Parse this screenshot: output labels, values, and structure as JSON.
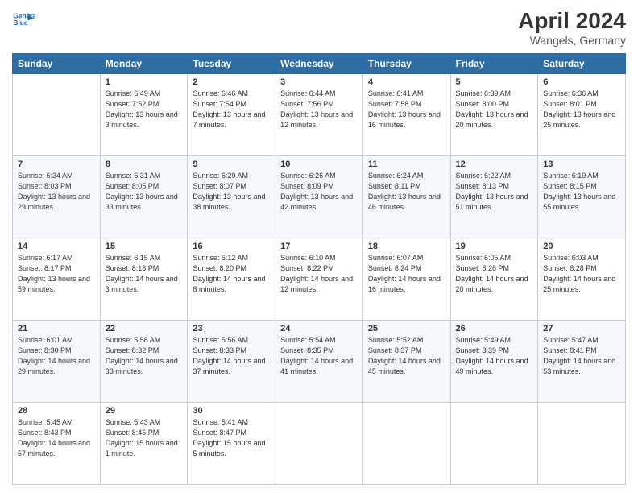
{
  "header": {
    "logo_line1": "General",
    "logo_line2": "Blue",
    "month": "April 2024",
    "location": "Wangels, Germany"
  },
  "weekdays": [
    "Sunday",
    "Monday",
    "Tuesday",
    "Wednesday",
    "Thursday",
    "Friday",
    "Saturday"
  ],
  "weeks": [
    [
      {
        "day": "",
        "sunrise": "",
        "sunset": "",
        "daylight": ""
      },
      {
        "day": "1",
        "sunrise": "Sunrise: 6:49 AM",
        "sunset": "Sunset: 7:52 PM",
        "daylight": "Daylight: 13 hours and 3 minutes."
      },
      {
        "day": "2",
        "sunrise": "Sunrise: 6:46 AM",
        "sunset": "Sunset: 7:54 PM",
        "daylight": "Daylight: 13 hours and 7 minutes."
      },
      {
        "day": "3",
        "sunrise": "Sunrise: 6:44 AM",
        "sunset": "Sunset: 7:56 PM",
        "daylight": "Daylight: 13 hours and 12 minutes."
      },
      {
        "day": "4",
        "sunrise": "Sunrise: 6:41 AM",
        "sunset": "Sunset: 7:58 PM",
        "daylight": "Daylight: 13 hours and 16 minutes."
      },
      {
        "day": "5",
        "sunrise": "Sunrise: 6:39 AM",
        "sunset": "Sunset: 8:00 PM",
        "daylight": "Daylight: 13 hours and 20 minutes."
      },
      {
        "day": "6",
        "sunrise": "Sunrise: 6:36 AM",
        "sunset": "Sunset: 8:01 PM",
        "daylight": "Daylight: 13 hours and 25 minutes."
      }
    ],
    [
      {
        "day": "7",
        "sunrise": "Sunrise: 6:34 AM",
        "sunset": "Sunset: 8:03 PM",
        "daylight": "Daylight: 13 hours and 29 minutes."
      },
      {
        "day": "8",
        "sunrise": "Sunrise: 6:31 AM",
        "sunset": "Sunset: 8:05 PM",
        "daylight": "Daylight: 13 hours and 33 minutes."
      },
      {
        "day": "9",
        "sunrise": "Sunrise: 6:29 AM",
        "sunset": "Sunset: 8:07 PM",
        "daylight": "Daylight: 13 hours and 38 minutes."
      },
      {
        "day": "10",
        "sunrise": "Sunrise: 6:26 AM",
        "sunset": "Sunset: 8:09 PM",
        "daylight": "Daylight: 13 hours and 42 minutes."
      },
      {
        "day": "11",
        "sunrise": "Sunrise: 6:24 AM",
        "sunset": "Sunset: 8:11 PM",
        "daylight": "Daylight: 13 hours and 46 minutes."
      },
      {
        "day": "12",
        "sunrise": "Sunrise: 6:22 AM",
        "sunset": "Sunset: 8:13 PM",
        "daylight": "Daylight: 13 hours and 51 minutes."
      },
      {
        "day": "13",
        "sunrise": "Sunrise: 6:19 AM",
        "sunset": "Sunset: 8:15 PM",
        "daylight": "Daylight: 13 hours and 55 minutes."
      }
    ],
    [
      {
        "day": "14",
        "sunrise": "Sunrise: 6:17 AM",
        "sunset": "Sunset: 8:17 PM",
        "daylight": "Daylight: 13 hours and 59 minutes."
      },
      {
        "day": "15",
        "sunrise": "Sunrise: 6:15 AM",
        "sunset": "Sunset: 8:18 PM",
        "daylight": "Daylight: 14 hours and 3 minutes."
      },
      {
        "day": "16",
        "sunrise": "Sunrise: 6:12 AM",
        "sunset": "Sunset: 8:20 PM",
        "daylight": "Daylight: 14 hours and 8 minutes."
      },
      {
        "day": "17",
        "sunrise": "Sunrise: 6:10 AM",
        "sunset": "Sunset: 8:22 PM",
        "daylight": "Daylight: 14 hours and 12 minutes."
      },
      {
        "day": "18",
        "sunrise": "Sunrise: 6:07 AM",
        "sunset": "Sunset: 8:24 PM",
        "daylight": "Daylight: 14 hours and 16 minutes."
      },
      {
        "day": "19",
        "sunrise": "Sunrise: 6:05 AM",
        "sunset": "Sunset: 8:26 PM",
        "daylight": "Daylight: 14 hours and 20 minutes."
      },
      {
        "day": "20",
        "sunrise": "Sunrise: 6:03 AM",
        "sunset": "Sunset: 8:28 PM",
        "daylight": "Daylight: 14 hours and 25 minutes."
      }
    ],
    [
      {
        "day": "21",
        "sunrise": "Sunrise: 6:01 AM",
        "sunset": "Sunset: 8:30 PM",
        "daylight": "Daylight: 14 hours and 29 minutes."
      },
      {
        "day": "22",
        "sunrise": "Sunrise: 5:58 AM",
        "sunset": "Sunset: 8:32 PM",
        "daylight": "Daylight: 14 hours and 33 minutes."
      },
      {
        "day": "23",
        "sunrise": "Sunrise: 5:56 AM",
        "sunset": "Sunset: 8:33 PM",
        "daylight": "Daylight: 14 hours and 37 minutes."
      },
      {
        "day": "24",
        "sunrise": "Sunrise: 5:54 AM",
        "sunset": "Sunset: 8:35 PM",
        "daylight": "Daylight: 14 hours and 41 minutes."
      },
      {
        "day": "25",
        "sunrise": "Sunrise: 5:52 AM",
        "sunset": "Sunset: 8:37 PM",
        "daylight": "Daylight: 14 hours and 45 minutes."
      },
      {
        "day": "26",
        "sunrise": "Sunrise: 5:49 AM",
        "sunset": "Sunset: 8:39 PM",
        "daylight": "Daylight: 14 hours and 49 minutes."
      },
      {
        "day": "27",
        "sunrise": "Sunrise: 5:47 AM",
        "sunset": "Sunset: 8:41 PM",
        "daylight": "Daylight: 14 hours and 53 minutes."
      }
    ],
    [
      {
        "day": "28",
        "sunrise": "Sunrise: 5:45 AM",
        "sunset": "Sunset: 8:43 PM",
        "daylight": "Daylight: 14 hours and 57 minutes."
      },
      {
        "day": "29",
        "sunrise": "Sunrise: 5:43 AM",
        "sunset": "Sunset: 8:45 PM",
        "daylight": "Daylight: 15 hours and 1 minute."
      },
      {
        "day": "30",
        "sunrise": "Sunrise: 5:41 AM",
        "sunset": "Sunset: 8:47 PM",
        "daylight": "Daylight: 15 hours and 5 minutes."
      },
      {
        "day": "",
        "sunrise": "",
        "sunset": "",
        "daylight": ""
      },
      {
        "day": "",
        "sunrise": "",
        "sunset": "",
        "daylight": ""
      },
      {
        "day": "",
        "sunrise": "",
        "sunset": "",
        "daylight": ""
      },
      {
        "day": "",
        "sunrise": "",
        "sunset": "",
        "daylight": ""
      }
    ]
  ]
}
